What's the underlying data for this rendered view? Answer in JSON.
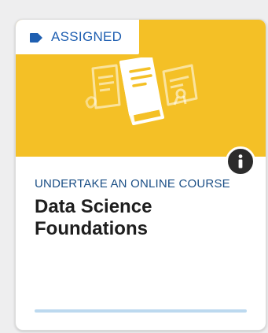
{
  "card": {
    "badge": {
      "label": "ASSIGNED",
      "icon": "tag-icon"
    },
    "banner": {
      "color": "#f4c026",
      "illustration": "course-book-icon"
    },
    "info_icon": "info-icon",
    "activity_type": "UNDERTAKE AN ONLINE COURSE",
    "title": "Data Science Foundations",
    "progress": 0
  },
  "colors": {
    "accent": "#1f5fb1",
    "banner": "#f4c026",
    "type_label": "#1b4f86",
    "progress_track": "#bcd9ef"
  }
}
